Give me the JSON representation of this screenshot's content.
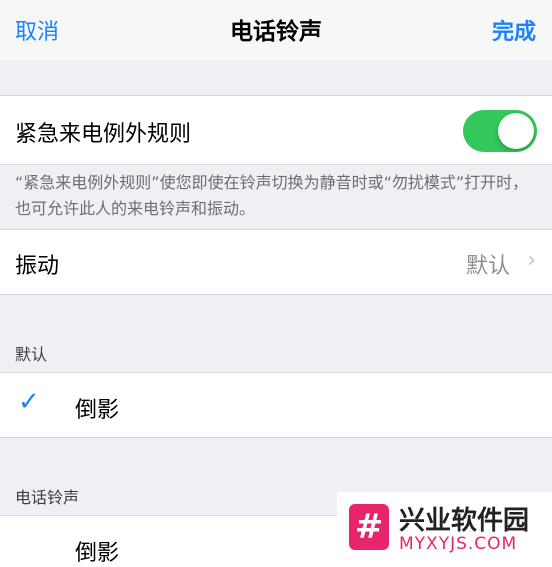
{
  "nav": {
    "cancel_label": "取消",
    "title": "电话铃声",
    "done_label": "完成"
  },
  "emergency_bypass": {
    "label": "紧急来电例外规则",
    "enabled": true,
    "footnote": "“紧急来电例外规则”使您即使在铃声切换为静音时或“勿扰模式”打开时，也可允许此人的来电铃声和振动。"
  },
  "vibration": {
    "label": "振动",
    "value": "默认"
  },
  "sections": [
    {
      "header": "默认",
      "items": [
        {
          "label": "倒影",
          "checked": true
        }
      ]
    },
    {
      "header": "电话铃声",
      "items": [
        {
          "label": "倒影",
          "checked": false
        }
      ]
    }
  ],
  "watermark": {
    "badge": "#",
    "text": "兴业软件园",
    "domain": "MYXYJS.COM"
  },
  "colors": {
    "accent": "#1a82fb",
    "toggle_on": "#34c759",
    "background": "#efeff4"
  }
}
